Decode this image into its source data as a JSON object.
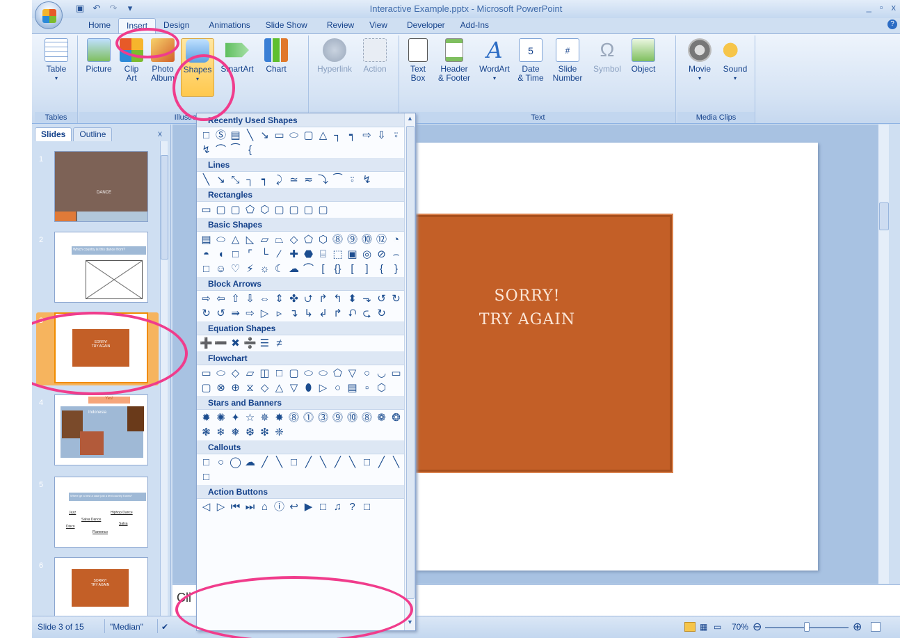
{
  "window": {
    "title": "Interactive Example.pptx - Microsoft PowerPoint",
    "minimize": "_",
    "maximize": "▫",
    "close": "x"
  },
  "qat": {
    "save": "💾",
    "undo": "↶",
    "redo": "↷",
    "more": "⫶"
  },
  "tabs": [
    "Home",
    "Insert",
    "Design",
    "Animations",
    "Slide Show",
    "Review",
    "View",
    "Developer",
    "Add-Ins"
  ],
  "active_tab": "Insert",
  "ribbon": {
    "groups": {
      "tables": "Tables",
      "illustrations": "Illustrations",
      "text": "Text",
      "media": "Media Clips"
    },
    "buttons": {
      "table": "Table",
      "picture": "Picture",
      "clip_art_1": "Clip",
      "clip_art_2": "Art",
      "photo_1": "Photo",
      "photo_2": "Album",
      "shapes": "Shapes",
      "smartart": "SmartArt",
      "chart": "Chart",
      "hyperlink": "Hyperlink",
      "action": "Action",
      "textbox_1": "Text",
      "textbox_2": "Box",
      "header_1": "Header",
      "header_2": "& Footer",
      "wordart": "WordArt",
      "date_1": "Date",
      "date_2": "& Time",
      "slide_1": "Slide",
      "slide_2": "Number",
      "symbol": "Symbol",
      "object": "Object",
      "movie": "Movie",
      "sound": "Sound"
    }
  },
  "left_panel": {
    "tab_slides": "Slides",
    "tab_outline": "Outline",
    "close": "x",
    "slide_numbers": [
      "1",
      "2",
      "3",
      "4",
      "5",
      "6"
    ],
    "slide1_text": "DANCE",
    "slide2_text": "Which country is this dance from?",
    "slide3_text_1": "SORRY!",
    "slide3_text_2": "TRY AGAIN",
    "slide4_badge": "Yes!",
    "slide4_country": "Indonesia",
    "slide5_text": "Where ge a best a case just a tent country Korea?",
    "slide5_words": [
      "Jazz",
      "Salsa Dance",
      "Disco",
      "Hiphop Dance",
      "Salsa",
      "Flamenco"
    ],
    "slide6_text_1": "SORRY!",
    "slide6_text_2": "TRY AGAIN"
  },
  "slide": {
    "line1": "SORRY!",
    "line2": "TRY AGAIN"
  },
  "notes": {
    "placeholder": "Cli"
  },
  "status": {
    "slide_count": "Slide 3 of 15",
    "theme": "\"Median\"",
    "zoom": "70%",
    "zoom_minus": "⊖",
    "zoom_plus": "⊕"
  },
  "shapes_menu": {
    "sections": [
      {
        "title": "Recently Used Shapes",
        "glyphs": [
          "□",
          "Ⓢ",
          "▤",
          "╲",
          "↘",
          "▭",
          "⬭",
          "▢",
          "△",
          "┐",
          "┑",
          "⇨",
          "⇩",
          "⍤",
          "↯",
          "⌒",
          "⁀",
          "{"
        ]
      },
      {
        "title": "Lines",
        "glyphs": [
          "╲",
          "↘",
          "⤡",
          "┐",
          "┑",
          "⤸",
          "≃",
          "≂",
          "⤵",
          "⁀",
          "⍤",
          "↯"
        ]
      },
      {
        "title": "Rectangles",
        "glyphs": [
          "▭",
          "▢",
          "▢",
          "⬠",
          "⬡",
          "▢",
          "▢",
          "▢",
          "▢"
        ]
      },
      {
        "title": "Basic Shapes",
        "glyphs": [
          "▤",
          "⬭",
          "△",
          "◺",
          "▱",
          "⏢",
          "◇",
          "⬠",
          "⬡",
          "⓼",
          "⓽",
          "⓾",
          "⑫",
          "◔",
          "◓",
          "◖",
          "□",
          "⌜",
          "└",
          "∕",
          "✚",
          "⬣",
          "⌸",
          "⬚",
          "▣",
          "◎",
          "⊘",
          "⌢",
          "□",
          "☺",
          "♡",
          "⚡",
          "☼",
          "☾",
          "☁",
          "⌒",
          "[",
          "{}",
          "[",
          "]",
          "{",
          "}"
        ]
      },
      {
        "title": "Block Arrows",
        "glyphs": [
          "⇨",
          "⇦",
          "⇧",
          "⇩",
          "⇔",
          "⇕",
          "✤",
          "⮍",
          "↱",
          "↰",
          "⬍",
          "⬎",
          "↺",
          "↻",
          "↻",
          "↺",
          "⇛",
          "⇨",
          "▷",
          "▹",
          "↴",
          "↳",
          "↲",
          "↱",
          "⮏",
          "⮎",
          "↻"
        ]
      },
      {
        "title": "Equation Shapes",
        "glyphs": [
          "➕",
          "➖",
          "✖",
          "➗",
          "☰",
          "≠"
        ]
      },
      {
        "title": "Flowchart",
        "glyphs": [
          "▭",
          "⬭",
          "◇",
          "▱",
          "◫",
          "□",
          "▢",
          "⬭",
          "⬭",
          "⬠",
          "▽",
          "○",
          "◡",
          "▭",
          "▢",
          "⊗",
          "⊕",
          "⧖",
          "◇",
          "△",
          "▽",
          "⬮",
          "▷",
          "○",
          "▤",
          "▫",
          "⬡"
        ]
      },
      {
        "title": "Stars and Banners",
        "glyphs": [
          "✹",
          "✺",
          "✦",
          "☆",
          "✵",
          "✸",
          "⓼",
          "⓵",
          "⓷",
          "⓽",
          "⓾",
          "⓼",
          "❁",
          "❂",
          "❃",
          "❄",
          "❅",
          "❆",
          "❇",
          "❈"
        ]
      },
      {
        "title": "Callouts",
        "glyphs": [
          "□",
          "○",
          "◯",
          "☁",
          "╱",
          "╲",
          "□",
          "╱",
          "╲",
          "╱",
          "╲",
          "□",
          "╱",
          "╲",
          "□"
        ]
      },
      {
        "title": "Action Buttons",
        "glyphs": [
          "◁",
          "▷",
          "⏮",
          "⏭",
          "⌂",
          "ⓘ",
          "↩",
          "▶",
          "□",
          "♫",
          "?",
          "□"
        ]
      }
    ]
  }
}
